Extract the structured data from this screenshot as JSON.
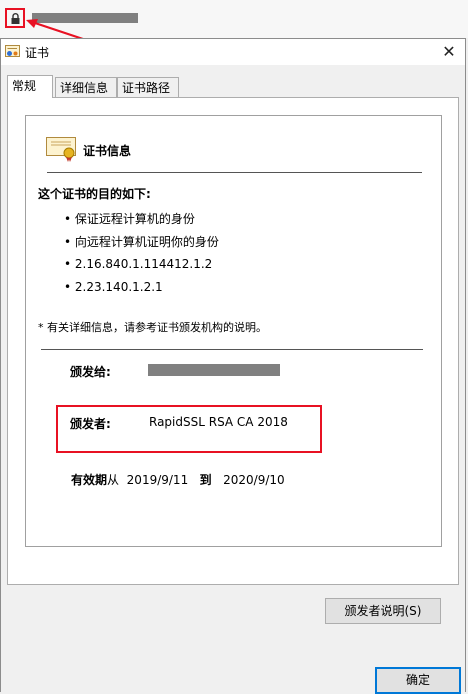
{
  "browser": {
    "lock_icon": "lock-icon",
    "annotation_color": "#e81123"
  },
  "dialog": {
    "title": "证书",
    "close_symbol": "✕",
    "tabs": [
      {
        "label": "常规",
        "active": true
      },
      {
        "label": "详细信息",
        "active": false
      },
      {
        "label": "证书路径",
        "active": false
      }
    ]
  },
  "general": {
    "cert_info_title": "证书信息",
    "purpose_heading": "这个证书的目的如下:",
    "purposes": [
      "• 保证远程计算机的身份",
      "• 向远程计算机证明你的身份",
      "• 2.16.840.1.114412.1.2",
      "• 2.23.140.1.2.1"
    ],
    "note": "* 有关详细信息，请参考证书颁发机构的说明。",
    "issued_to_label": "颁发给:",
    "issuer_label": "颁发者:",
    "issuer_value": "RapidSSL RSA CA 2018",
    "validity_label": "有效期",
    "validity_from_word": "从",
    "valid_from": "2019/9/11",
    "validity_to_word": "到",
    "valid_to": "2020/9/10",
    "issuer_statement_button": "颁发者说明(S)"
  },
  "footer": {
    "ok_button": "确定"
  }
}
